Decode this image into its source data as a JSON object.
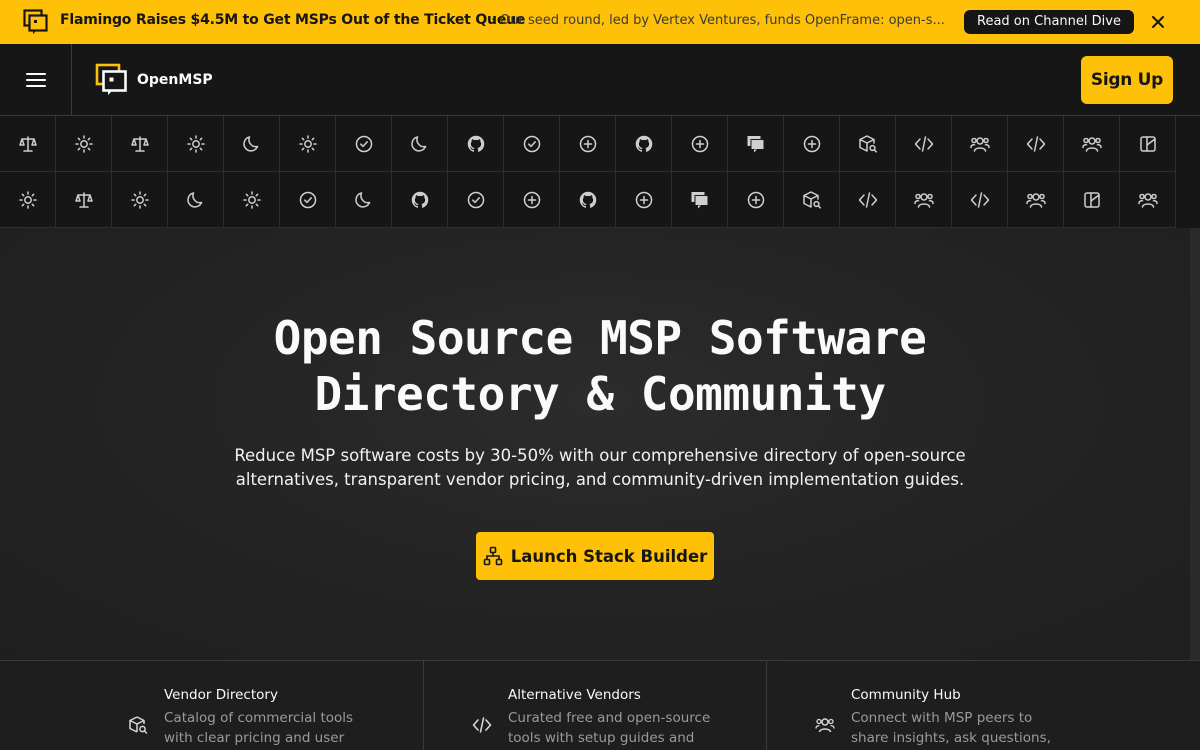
{
  "announcement": {
    "headline": "Flamingo Raises $4.5M to Get MSPs Out of the Ticket Queue",
    "separator": "·",
    "description": "Our seed round, led by Vertex Ventures, funds OpenFrame: open-s...",
    "read_label": "Read on Channel Dive",
    "close_icon": "close-icon",
    "logo_icon": "openmsp-logo-icon"
  },
  "header": {
    "brand": "OpenMSP",
    "menu_icon": "hamburger-menu-icon",
    "signup_label": "Sign Up"
  },
  "icon_grid": {
    "row1": [
      "scale",
      "sun",
      "scale",
      "sun",
      "moon",
      "sun",
      "check-circle",
      "moon",
      "github",
      "check-circle",
      "plus-circle",
      "github",
      "plus-circle",
      "chat",
      "plus-circle",
      "box-search",
      "code",
      "users",
      "code",
      "users",
      "layout"
    ],
    "row2": [
      "sun",
      "scale",
      "sun",
      "moon",
      "sun",
      "check-circle",
      "moon",
      "github",
      "check-circle",
      "plus-circle",
      "github",
      "plus-circle",
      "chat",
      "plus-circle",
      "box-search",
      "code",
      "users",
      "code",
      "users",
      "layout",
      "users"
    ]
  },
  "hero": {
    "title_line1": "Open Source MSP Software",
    "title_line2": "Directory & Community",
    "subtitle_line1": "Reduce MSP software costs by 30-50% with our comprehensive directory of open-source",
    "subtitle_line2": "alternatives, transparent vendor pricing, and community-driven implementation guides.",
    "cta_label": "Launch Stack Builder",
    "cta_icon": "sitemap-icon"
  },
  "features": [
    {
      "title": "Vendor Directory",
      "description": "Catalog of commercial tools with clear pricing and user",
      "icon": "box-search-icon"
    },
    {
      "title": "Alternative Vendors",
      "description": "Curated free and open-source tools with setup guides and",
      "icon": "code-icon"
    },
    {
      "title": "Community Hub",
      "description": "Connect with MSP peers to share insights, ask questions,",
      "icon": "users-icon"
    }
  ],
  "colors": {
    "accent": "#ffc008",
    "background": "#212121",
    "header_bg": "#161616",
    "text": "#fafafa",
    "muted_text": "#9a9a9a"
  }
}
